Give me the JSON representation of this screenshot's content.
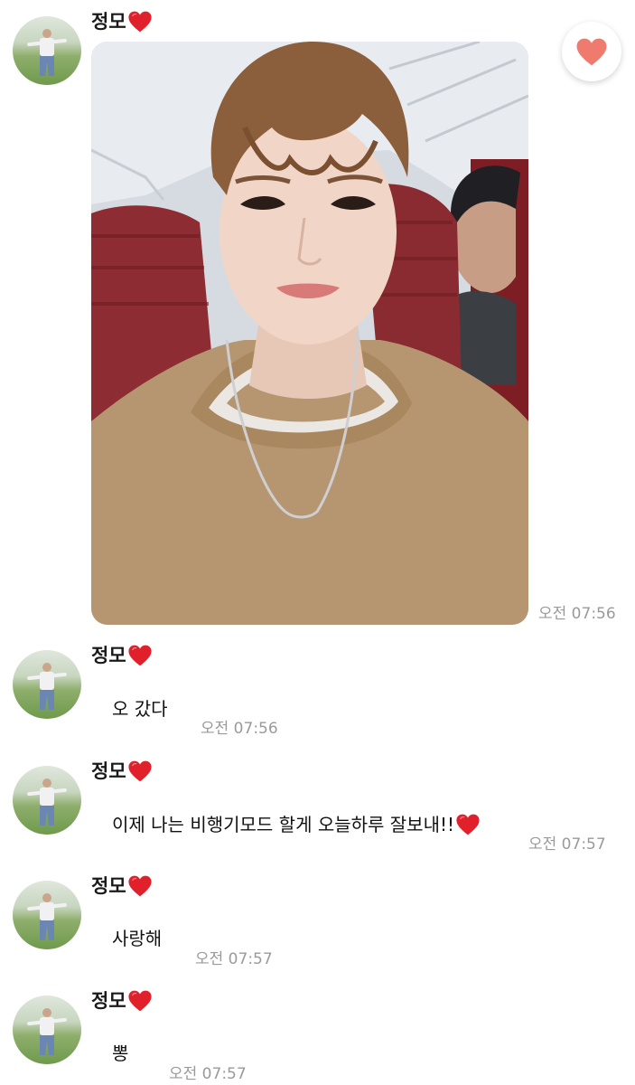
{
  "post": {
    "sender": "정모",
    "time": "오전 07:56",
    "like_icon": "heart-icon",
    "like_color": "#ef7a6e"
  },
  "messages": [
    {
      "sender": "정모",
      "text": "오 갔다",
      "time": "오전 07:56"
    },
    {
      "sender": "정모",
      "text": "이제 나는 비행기모드 할게 오늘하루 잘보내!!",
      "time": "오전 07:57"
    },
    {
      "sender": "정모",
      "text": "사랑해",
      "time": "오전 07:57"
    },
    {
      "sender": "정모",
      "text": "뽕",
      "time": "오전 07:57"
    }
  ],
  "colors": {
    "heart_emoji": "#e0202b",
    "timestamp": "#9a9a9a"
  }
}
